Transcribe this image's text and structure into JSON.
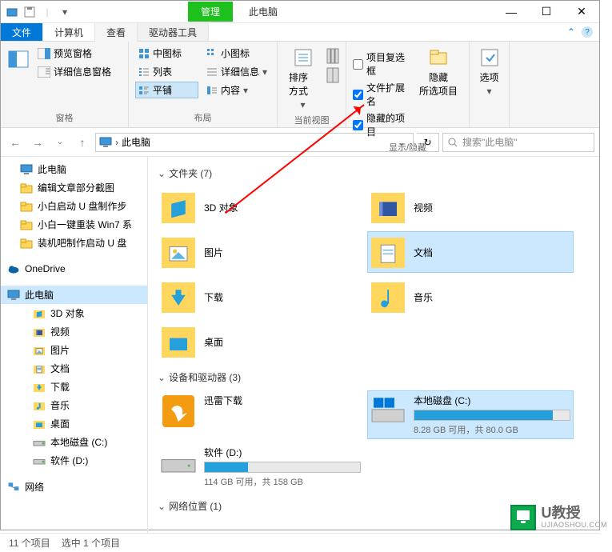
{
  "titlebar": {
    "manage": "管理",
    "title": "此电脑"
  },
  "tabs": {
    "file": "文件",
    "computer": "计算机",
    "view": "查看",
    "drive": "驱动器工具"
  },
  "ribbon": {
    "panes": {
      "preview": "预览窗格",
      "details": "详细信息窗格",
      "label": "窗格"
    },
    "layout": {
      "medium": "中图标",
      "small": "小图标",
      "list": "列表",
      "detail": "详细信息",
      "tiles": "平铺",
      "content": "内容",
      "label": "布局"
    },
    "view": {
      "sort": "排序方式",
      "label": "当前视图"
    },
    "show": {
      "checkboxes": "项目复选框",
      "ext": "文件扩展名",
      "hidden": "隐藏的项目",
      "hide": "隐藏\n所选项目",
      "label": "显示/隐藏"
    },
    "options": {
      "opt": "选项"
    }
  },
  "address": {
    "path": "此电脑",
    "search": "搜索\"此电脑\""
  },
  "tree": [
    {
      "label": "此电脑",
      "icon": "pc",
      "depth": 0
    },
    {
      "label": "编辑文章部分截图",
      "icon": "folder",
      "depth": 0
    },
    {
      "label": "小白启动 U 盘制作步",
      "icon": "folder",
      "depth": 0
    },
    {
      "label": "小白一键重装 Win7 系",
      "icon": "folder",
      "depth": 0
    },
    {
      "label": "装机吧制作启动 U 盘",
      "icon": "folder",
      "depth": 0
    },
    {
      "label": "OneDrive",
      "icon": "onedrive",
      "depth": -1
    },
    {
      "label": "此电脑",
      "icon": "pc",
      "depth": -1,
      "selected": true
    },
    {
      "label": "3D 对象",
      "icon": "3d",
      "depth": 2
    },
    {
      "label": "视频",
      "icon": "video",
      "depth": 2
    },
    {
      "label": "图片",
      "icon": "pictures",
      "depth": 2
    },
    {
      "label": "文档",
      "icon": "docs",
      "depth": 2
    },
    {
      "label": "下载",
      "icon": "downloads",
      "depth": 2
    },
    {
      "label": "音乐",
      "icon": "music",
      "depth": 2
    },
    {
      "label": "桌面",
      "icon": "desktop",
      "depth": 2
    },
    {
      "label": "本地磁盘 (C:)",
      "icon": "drive",
      "depth": 2
    },
    {
      "label": "软件 (D:)",
      "icon": "drive",
      "depth": 2
    },
    {
      "label": "网络",
      "icon": "network",
      "depth": -1
    }
  ],
  "sections": {
    "folders": {
      "title": "文件夹 (7)",
      "items": [
        {
          "label": "3D 对象",
          "icon": "3d"
        },
        {
          "label": "视频",
          "icon": "video"
        },
        {
          "label": "图片",
          "icon": "pictures"
        },
        {
          "label": "文档",
          "icon": "docs",
          "selected": true
        },
        {
          "label": "下载",
          "icon": "downloads"
        },
        {
          "label": "音乐",
          "icon": "music"
        },
        {
          "label": "桌面",
          "icon": "desktop"
        }
      ]
    },
    "drives": {
      "title": "设备和驱动器 (3)",
      "items": [
        {
          "label": "迅雷下载",
          "icon": "xunlei"
        },
        {
          "label": "本地磁盘 (C:)",
          "icon": "drive",
          "free": "8.28 GB 可用，共 80.0 GB",
          "pct": 89,
          "selected": true
        },
        {
          "label": "软件 (D:)",
          "icon": "drive",
          "free": "114 GB 可用，共 158 GB",
          "pct": 28
        }
      ]
    },
    "network": {
      "title": "网络位置 (1)"
    }
  },
  "status": {
    "count": "11 个项目",
    "sel": "选中 1 个项目"
  },
  "watermark": {
    "brand": "U教授",
    "url": "UJIAOSHOU.COM"
  }
}
